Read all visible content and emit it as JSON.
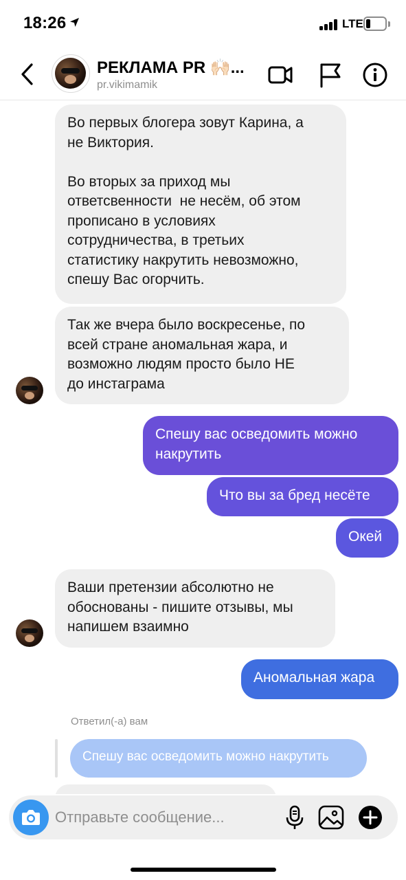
{
  "status_bar": {
    "time": "18:26",
    "network": "LTE"
  },
  "header": {
    "name": "РЕКЛАМА PR 🙌🏻...",
    "handle": "pr.vikimamik"
  },
  "messages": [
    {
      "from": "them",
      "text": "Во первых блогера зовут Карина, а\nне Виктория.\n\nВо вторых за приход мы\nответсвенности  не несём, об этом\nпрописано в условиях\nсотрудничества, в третьих\nстатистику накрутить невозможно,\nспешу Вас огорчить."
    },
    {
      "from": "them",
      "text": "Так же вчера было воскресенье, по\nвсей стране аномальная жара, и\nвозможно людям просто было НЕ\nдо инстаграма"
    },
    {
      "from": "me",
      "text": "Спешу вас осведомить можно\nнакрутить"
    },
    {
      "from": "me",
      "text": "Что вы за бред несёте"
    },
    {
      "from": "me",
      "text": "Окей"
    },
    {
      "from": "them",
      "text": "Ваши претензии абсолютно не\nобоснованы - пишите отзывы, мы\nнапишем взаимно"
    },
    {
      "from": "me",
      "text": "Аномальная жара"
    }
  ],
  "reply": {
    "label": "Ответил(-а) вам",
    "quoted": "Спешу вас осведомить можно накрутить"
  },
  "composer": {
    "placeholder": "Отправьте сообщение..."
  },
  "colors": {
    "incoming": "#efefef",
    "outgoing_purple": "#6a4fd8",
    "outgoing_blue": "#3f6ee0",
    "camera": "#3897f0"
  }
}
